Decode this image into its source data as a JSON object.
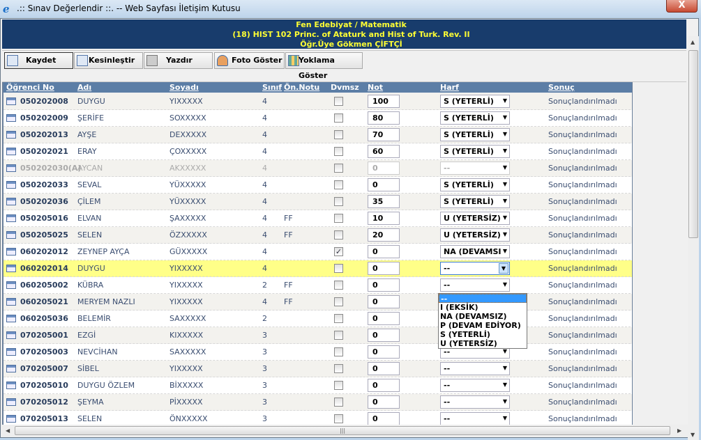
{
  "window": {
    "title": ".:: Sınav Değerlendir ::. -- Web Sayfası İletişim Kutusu",
    "close": "X"
  },
  "header": {
    "line1": "Fen Edebiyat / Matematik",
    "line2": "(18) HIST 102 Princ. of Ataturk and Hist of Turk. Rev. II",
    "line3": "Öğr.Üye Gökmen ÇİFTÇİ"
  },
  "toolbar": {
    "save": "Kaydet",
    "finalize": "Kesinleştir",
    "print": "Yazdır",
    "photo": "Foto Göster",
    "attendance": "Yoklama Göster"
  },
  "columns": {
    "no": "Öğrenci No",
    "ad": "Adı",
    "soyad": "Soyadı",
    "sinif": "Sınıf",
    "onnotu": "Ön.Notu",
    "dvmsz": "Dvmsz",
    "not": "Not",
    "harf": "Harf",
    "sonuc": "Sonuç"
  },
  "rows": [
    {
      "no": "050202008",
      "ad": "DUYGU",
      "soyad": "YIXXXXX",
      "sinif": "4",
      "on": "",
      "dv": false,
      "not": "100",
      "harf": "S (YETERLİ)",
      "sonuc": "Sonuçlandırılmadı"
    },
    {
      "no": "050202009",
      "ad": "ŞERİFE",
      "soyad": "SOXXXXX",
      "sinif": "4",
      "on": "",
      "dv": false,
      "not": "80",
      "harf": "S (YETERLİ)",
      "sonuc": "Sonuçlandırılmadı"
    },
    {
      "no": "050202013",
      "ad": "AYŞE",
      "soyad": "DEXXXXX",
      "sinif": "4",
      "on": "",
      "dv": false,
      "not": "70",
      "harf": "S (YETERLİ)",
      "sonuc": "Sonuçlandırılmadı"
    },
    {
      "no": "050202021",
      "ad": "ERAY",
      "soyad": "ÇOXXXXX",
      "sinif": "4",
      "on": "",
      "dv": false,
      "not": "60",
      "harf": "S (YETERLİ)",
      "sonuc": "Sonuçlandırılmadı"
    },
    {
      "no": "050202030(A)",
      "ad": "AYCAN",
      "soyad": "AKXXXXX",
      "sinif": "4",
      "on": "",
      "dv": false,
      "not": "0",
      "harf": "--",
      "sonuc": "Sonuçlandırılmadı",
      "disabled": true
    },
    {
      "no": "050202033",
      "ad": "SEVAL",
      "soyad": "YÜXXXXX",
      "sinif": "4",
      "on": "",
      "dv": false,
      "not": "0",
      "harf": "S (YETERLİ)",
      "sonuc": "Sonuçlandırılmadı"
    },
    {
      "no": "050202036",
      "ad": "ÇİLEM",
      "soyad": "YÜXXXXX",
      "sinif": "4",
      "on": "",
      "dv": false,
      "not": "35",
      "harf": "S (YETERLİ)",
      "sonuc": "Sonuçlandırılmadı"
    },
    {
      "no": "050205016",
      "ad": "ELVAN",
      "soyad": "ŞAXXXXX",
      "sinif": "4",
      "on": "FF",
      "dv": false,
      "not": "10",
      "harf": "U (YETERSİZ)",
      "sonuc": "Sonuçlandırılmadı"
    },
    {
      "no": "050205025",
      "ad": "SELEN",
      "soyad": "ÖZXXXXX",
      "sinif": "4",
      "on": "FF",
      "dv": false,
      "not": "20",
      "harf": "U (YETERSİZ)",
      "sonuc": "Sonuçlandırılmadı"
    },
    {
      "no": "060202012",
      "ad": "ZEYNEP AYÇA",
      "soyad": "GÜXXXXX",
      "sinif": "4",
      "on": "",
      "dv": true,
      "not": "0",
      "harf": "NA (DEVAMSI",
      "sonuc": "Sonuçlandırılmadı"
    },
    {
      "no": "060202014",
      "ad": "DUYGU",
      "soyad": "YIXXXXX",
      "sinif": "4",
      "on": "",
      "dv": false,
      "not": "0",
      "harf": "--",
      "sonuc": "Sonuçlandırılmadı",
      "selected": true
    },
    {
      "no": "060205002",
      "ad": "KÜBRA",
      "soyad": "YIXXXXX",
      "sinif": "2",
      "on": "FF",
      "dv": false,
      "not": "0",
      "harf": "--",
      "sonuc": "Sonuçlandırılmadı"
    },
    {
      "no": "060205021",
      "ad": "MERYEM NAZLI",
      "soyad": "YIXXXXX",
      "sinif": "4",
      "on": "FF",
      "dv": false,
      "not": "0",
      "harf": "--",
      "sonuc": "Sonuçlandırılmadı"
    },
    {
      "no": "060205036",
      "ad": "BELEMİR",
      "soyad": "SAXXXXX",
      "sinif": "2",
      "on": "",
      "dv": false,
      "not": "0",
      "harf": "--",
      "sonuc": "Sonuçlandırılmadı"
    },
    {
      "no": "070205001",
      "ad": "EZGİ",
      "soyad": "KIXXXXX",
      "sinif": "3",
      "on": "",
      "dv": false,
      "not": "0",
      "harf": "--",
      "sonuc": "Sonuçlandırılmadı"
    },
    {
      "no": "070205003",
      "ad": "NEVCİHAN",
      "soyad": "SAXXXXX",
      "sinif": "3",
      "on": "",
      "dv": false,
      "not": "0",
      "harf": "--",
      "sonuc": "Sonuçlandırılmadı"
    },
    {
      "no": "070205007",
      "ad": "SİBEL",
      "soyad": "YIXXXXX",
      "sinif": "3",
      "on": "",
      "dv": false,
      "not": "0",
      "harf": "--",
      "sonuc": "Sonuçlandırılmadı"
    },
    {
      "no": "070205010",
      "ad": "DUYGU ÖZLEM",
      "soyad": "BİXXXXX",
      "sinif": "3",
      "on": "",
      "dv": false,
      "not": "0",
      "harf": "--",
      "sonuc": "Sonuçlandırılmadı"
    },
    {
      "no": "070205012",
      "ad": "ŞEYMA",
      "soyad": "PİXXXXX",
      "sinif": "3",
      "on": "",
      "dv": false,
      "not": "0",
      "harf": "--",
      "sonuc": "Sonuçlandırılmadı"
    },
    {
      "no": "070205013",
      "ad": "SELEN",
      "soyad": "ÖNXXXXX",
      "sinif": "3",
      "on": "",
      "dv": false,
      "not": "0",
      "harf": "--",
      "sonuc": "Sonuçlandırılmadı"
    }
  ],
  "dropdown_options": [
    "--",
    "I (EKSİK)",
    "NA (DEVAMSIZ)",
    "P (DEVAM EDİYOR)",
    "S (YETERLİ)",
    "U (YETERSİZ)"
  ],
  "colors": {
    "header_bg": "#183c6c",
    "header_text": "#ffff33",
    "selected_row": "#ffff88",
    "grid_header": "#5c7ea6"
  }
}
